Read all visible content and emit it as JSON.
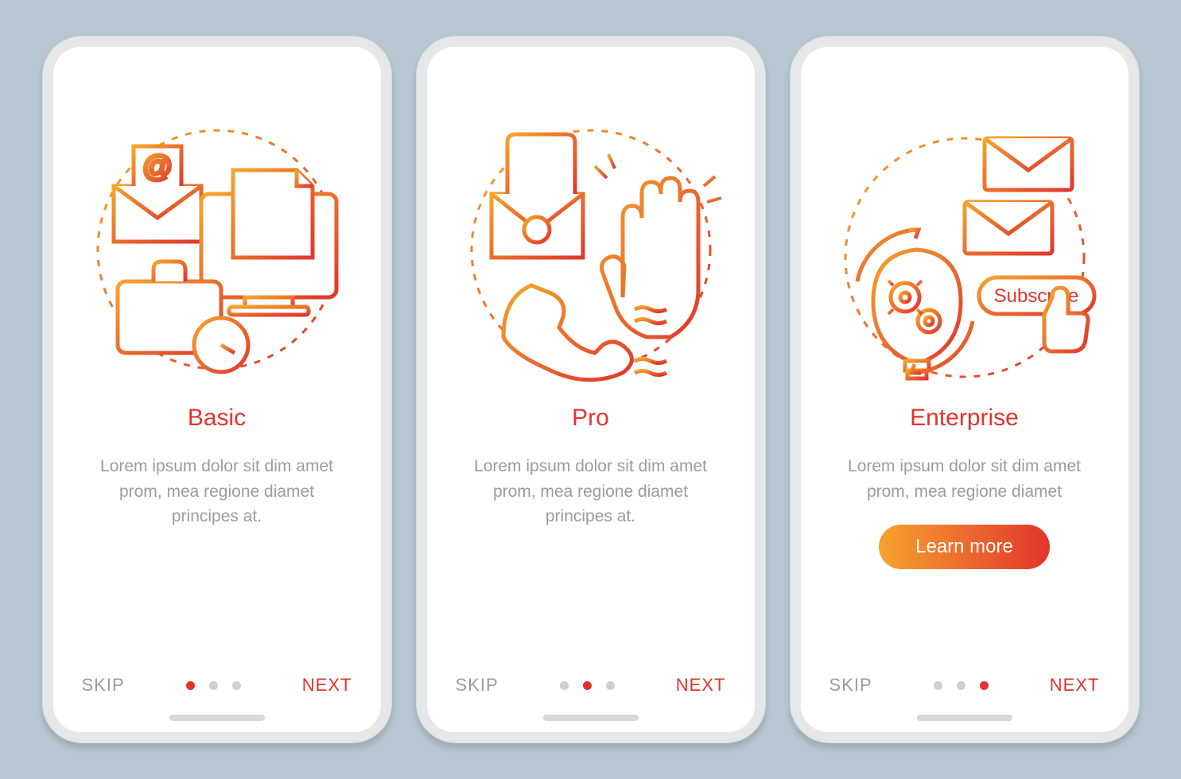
{
  "screens": [
    {
      "title": "Basic",
      "desc": "Lorem ipsum dolor sit dim amet prom, mea regione diamet principes at.",
      "skip": "SKIP",
      "next": "NEXT",
      "activeDot": 0,
      "cta": null,
      "icon": "basic"
    },
    {
      "title": "Pro",
      "desc": "Lorem ipsum dolor sit dim amet prom, mea regione diamet principes at.",
      "skip": "SKIP",
      "next": "NEXT",
      "activeDot": 1,
      "cta": null,
      "icon": "pro"
    },
    {
      "title": "Enterprise",
      "desc": "Lorem ipsum dolor sit dim amet prom, mea regione diamet",
      "skip": "SKIP",
      "next": "NEXT",
      "activeDot": 2,
      "cta": "Learn more",
      "subscribe_label": "Subscribe",
      "icon": "enterprise"
    }
  ]
}
